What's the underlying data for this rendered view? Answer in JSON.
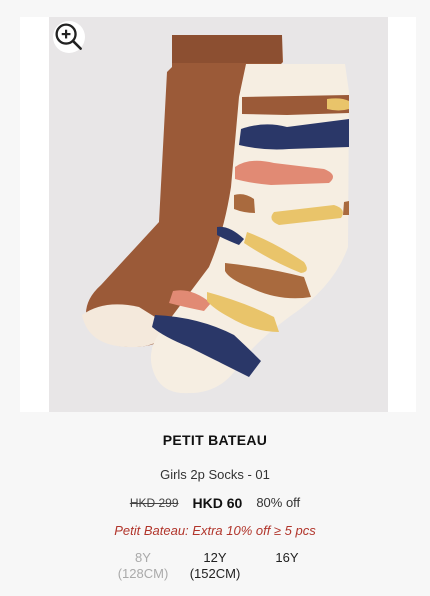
{
  "product": {
    "brand": "PETIT BATEAU",
    "name": "Girls 2p Socks - 01",
    "price_original": "HKD 299",
    "price_current": "HKD 60",
    "discount": "80% off",
    "promo": "Petit Bateau: Extra 10% off ≥ 5 pcs",
    "zoom_icon": "zoom-in-icon"
  },
  "sizes": [
    {
      "age": "8Y",
      "height": "(128CM)",
      "available": false
    },
    {
      "age": "12Y",
      "height": "(152CM)",
      "available": true
    },
    {
      "age": "16Y",
      "height": "",
      "available": true
    }
  ],
  "colors": {
    "promo": "#b1352b",
    "brown_sock": "#9b5a38",
    "cream_sock": "#f6eee2",
    "navy": "#2a3768",
    "coral": "#e18a74",
    "mustard": "#e9c46a",
    "tan": "#a96a3e"
  }
}
